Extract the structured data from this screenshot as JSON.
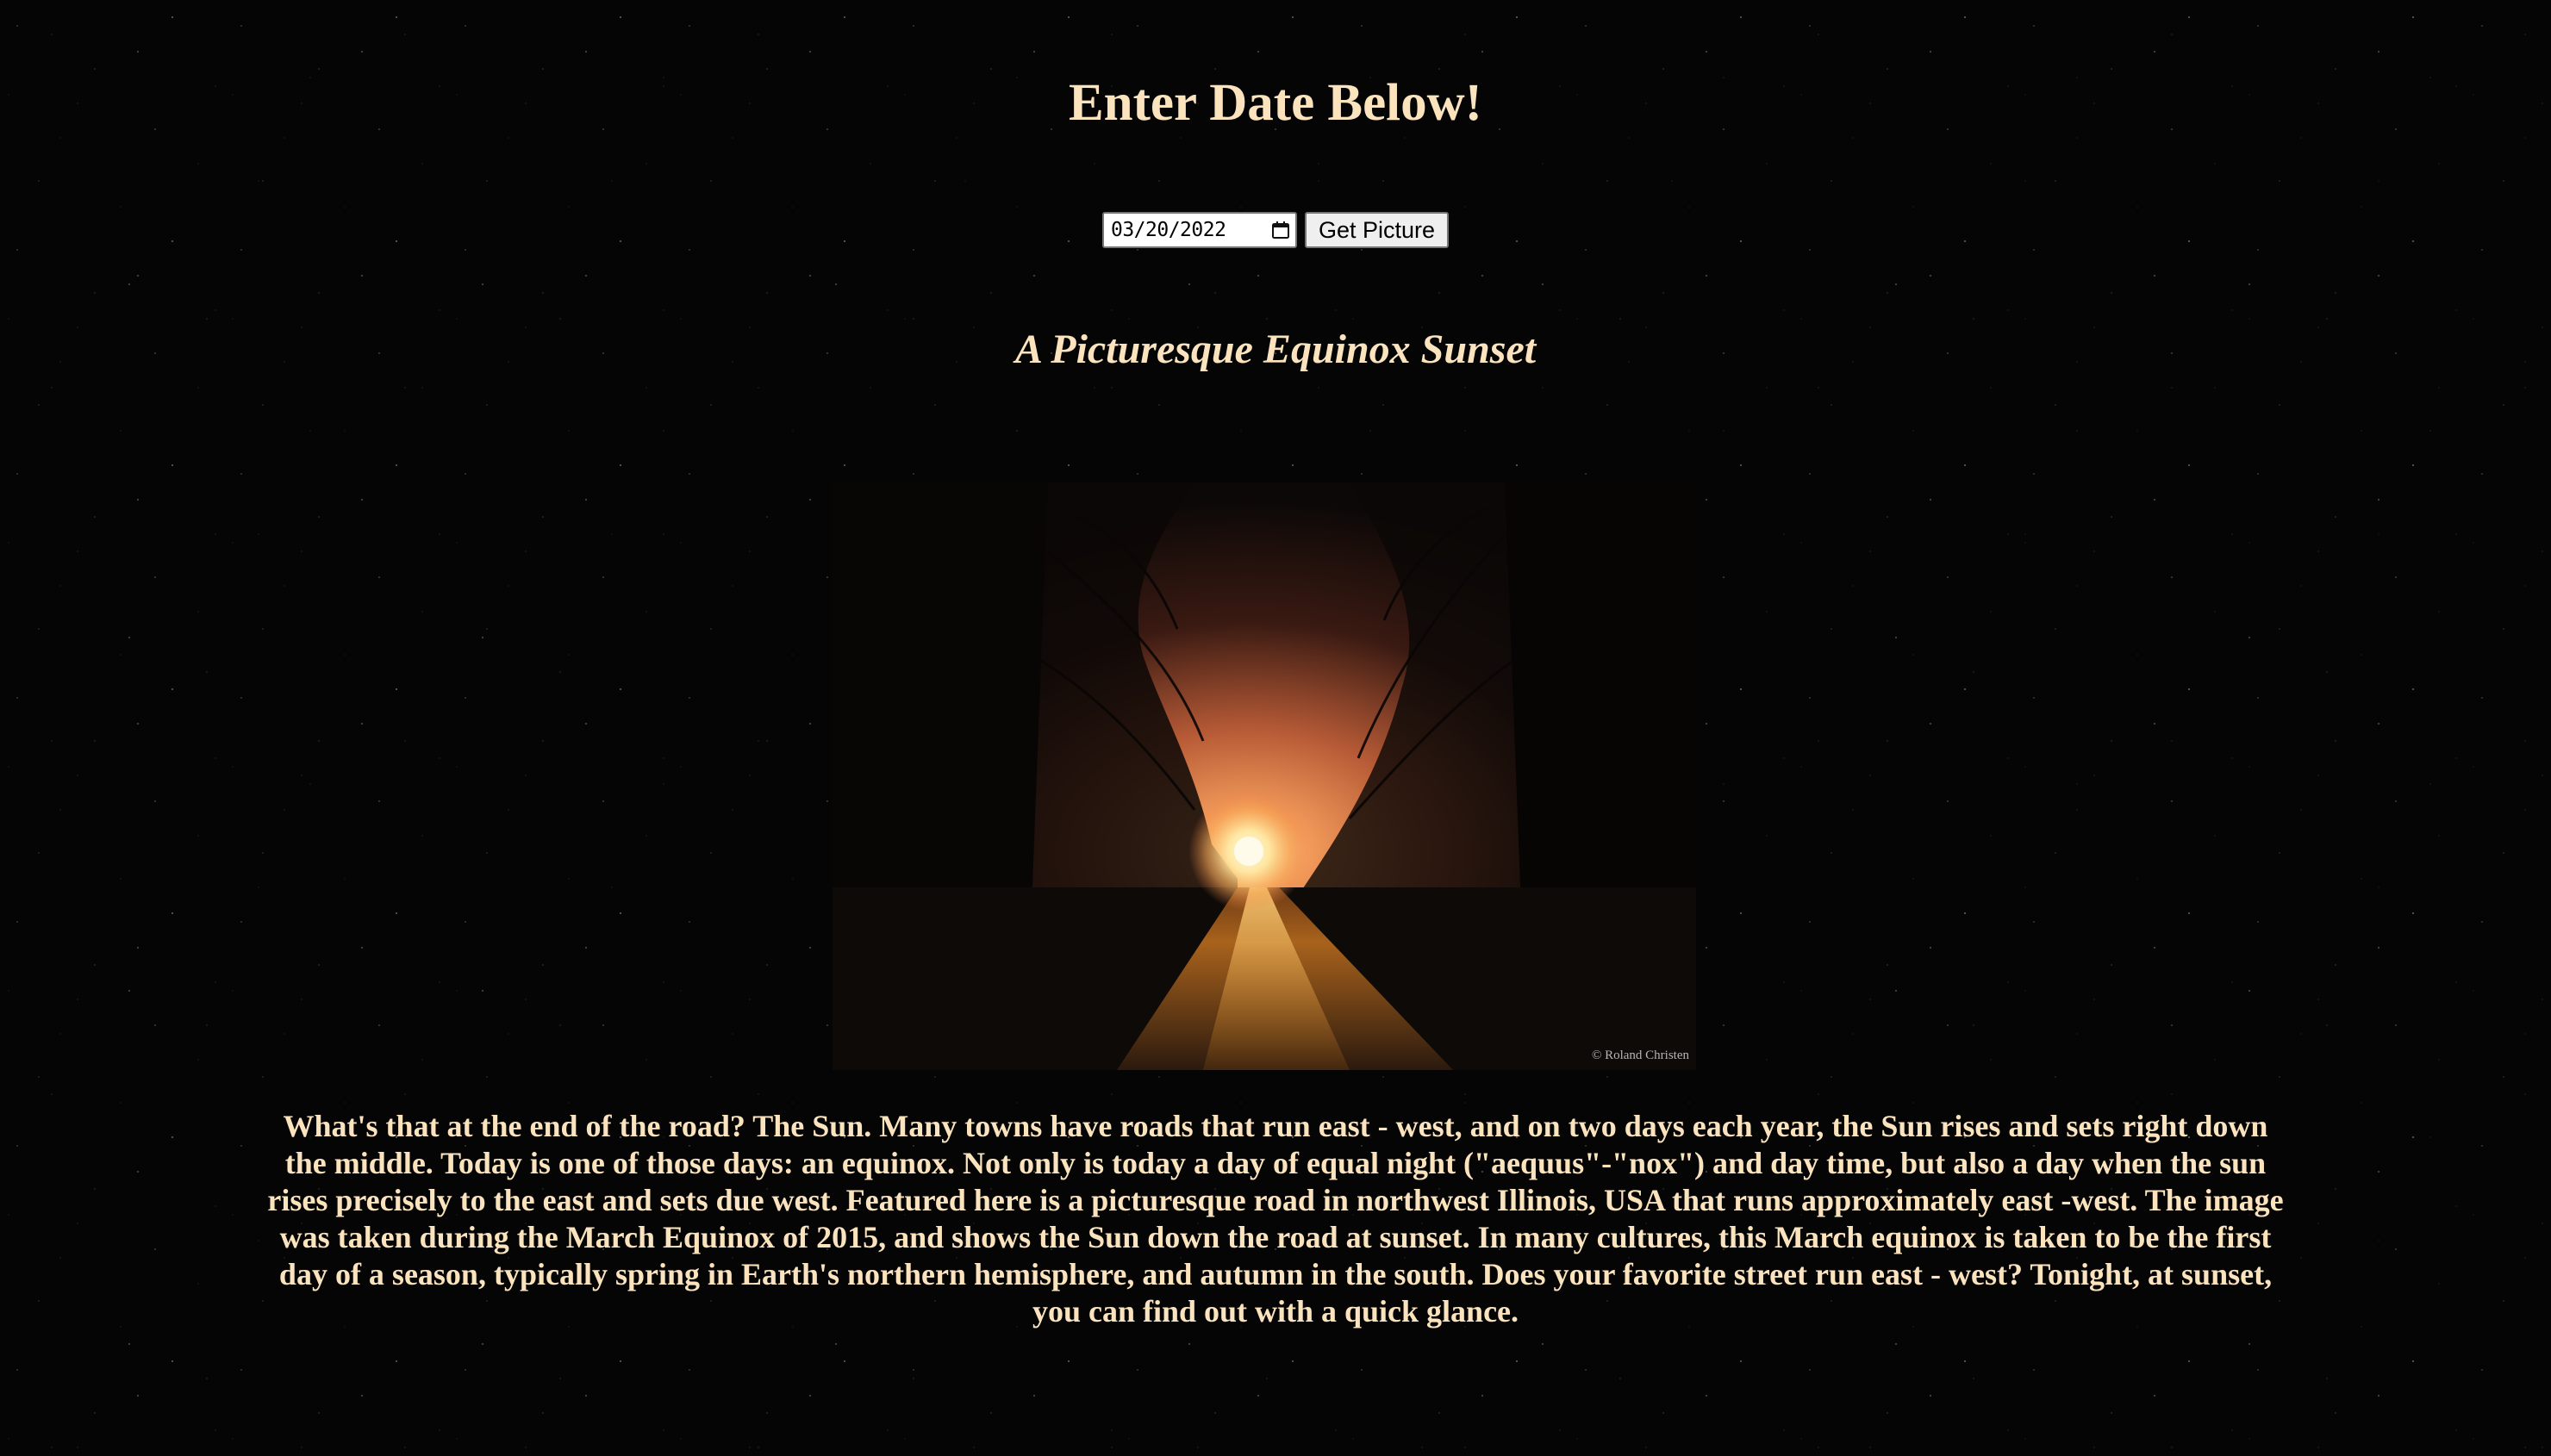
{
  "header": {
    "heading": "Enter Date Below!"
  },
  "form": {
    "date_value": "03/20/2022",
    "submit_label": "Get Picture",
    "calendar_icon": "calendar-icon"
  },
  "apod": {
    "title": "A Picturesque Equinox Sunset",
    "image_credit": "© Roland Christen",
    "explanation": "What's that at the end of the road? The Sun. Many towns have roads that run east - west, and on two days each year, the Sun rises and sets right down the middle. Today is one of those days: an equinox. Not only is today a day of equal night (\"aequus\"-\"nox\") and day time, but also a day when the sun rises precisely to the east and sets due west. Featured here is a picturesque road in northwest Illinois, USA that runs approximately east -west. The image was taken during the March Equinox of 2015, and shows the Sun down the road at sunset. In many cultures, this March equinox is taken to be the first day of a season, typically spring in Earth's northern hemisphere, and autumn in the south. Does your favorite street run east - west? Tonight, at sunset, you can find out with a quick glance."
  },
  "colors": {
    "text": "#fae3bd",
    "background": "#050505",
    "sky_glow": "#e8804a",
    "sun": "#fff6d0"
  }
}
